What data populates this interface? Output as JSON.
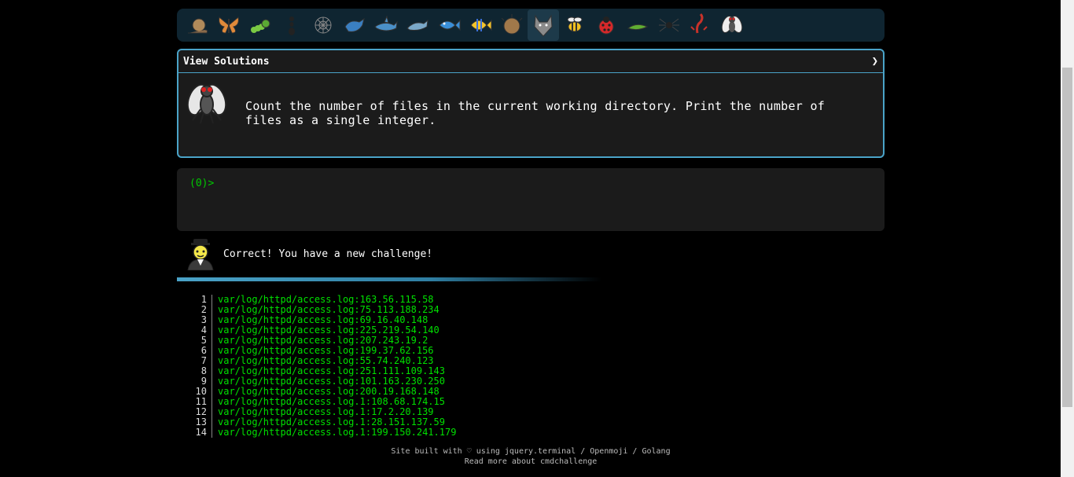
{
  "levels": [
    {
      "name": "snail"
    },
    {
      "name": "butterfly"
    },
    {
      "name": "caterpillar"
    },
    {
      "name": "ant"
    },
    {
      "name": "spider-web"
    },
    {
      "name": "whale"
    },
    {
      "name": "shark"
    },
    {
      "name": "dolphin"
    },
    {
      "name": "fish"
    },
    {
      "name": "tropical-fish"
    },
    {
      "name": "blowfish"
    },
    {
      "name": "wolf"
    },
    {
      "name": "bee"
    },
    {
      "name": "ladybug"
    },
    {
      "name": "cricket"
    },
    {
      "name": "spider"
    },
    {
      "name": "scorpion"
    },
    {
      "name": "fly"
    }
  ],
  "panel": {
    "title": "View Solutions",
    "chevron": "❯",
    "task": "Count the number of files in the current working directory. Print the number of files as a single integer."
  },
  "terminal": {
    "prompt": "(0)>"
  },
  "feedback": {
    "message": "Correct! You have a new challenge!"
  },
  "output": [
    {
      "n": "1",
      "text": "var/log/httpd/access.log:163.56.115.58"
    },
    {
      "n": "2",
      "text": "var/log/httpd/access.log:75.113.188.234"
    },
    {
      "n": "3",
      "text": "var/log/httpd/access.log:69.16.40.148"
    },
    {
      "n": "4",
      "text": "var/log/httpd/access.log:225.219.54.140"
    },
    {
      "n": "5",
      "text": "var/log/httpd/access.log:207.243.19.2"
    },
    {
      "n": "6",
      "text": "var/log/httpd/access.log:199.37.62.156"
    },
    {
      "n": "7",
      "text": "var/log/httpd/access.log:55.74.240.123"
    },
    {
      "n": "8",
      "text": "var/log/httpd/access.log:251.111.109.143"
    },
    {
      "n": "9",
      "text": "var/log/httpd/access.log:101.163.230.250"
    },
    {
      "n": "10",
      "text": "var/log/httpd/access.log:200.19.168.148"
    },
    {
      "n": "11",
      "text": "var/log/httpd/access.log.1:108.68.174.15"
    },
    {
      "n": "12",
      "text": "var/log/httpd/access.log.1:17.2.20.139"
    },
    {
      "n": "13",
      "text": "var/log/httpd/access.log.1:28.151.137.59"
    },
    {
      "n": "14",
      "text": "var/log/httpd/access.log.1:199.150.241.179"
    }
  ],
  "footer": {
    "line1": "Site built with ♡ using jquery.terminal / Openmoji / Golang",
    "line2": "Read more about cmdchallenge"
  },
  "colors": {
    "accent": "#4aa3c8",
    "terminal_green": "#00e000",
    "panel_bg": "#1b1b1b",
    "iconbar_bg": "#0f2531"
  }
}
